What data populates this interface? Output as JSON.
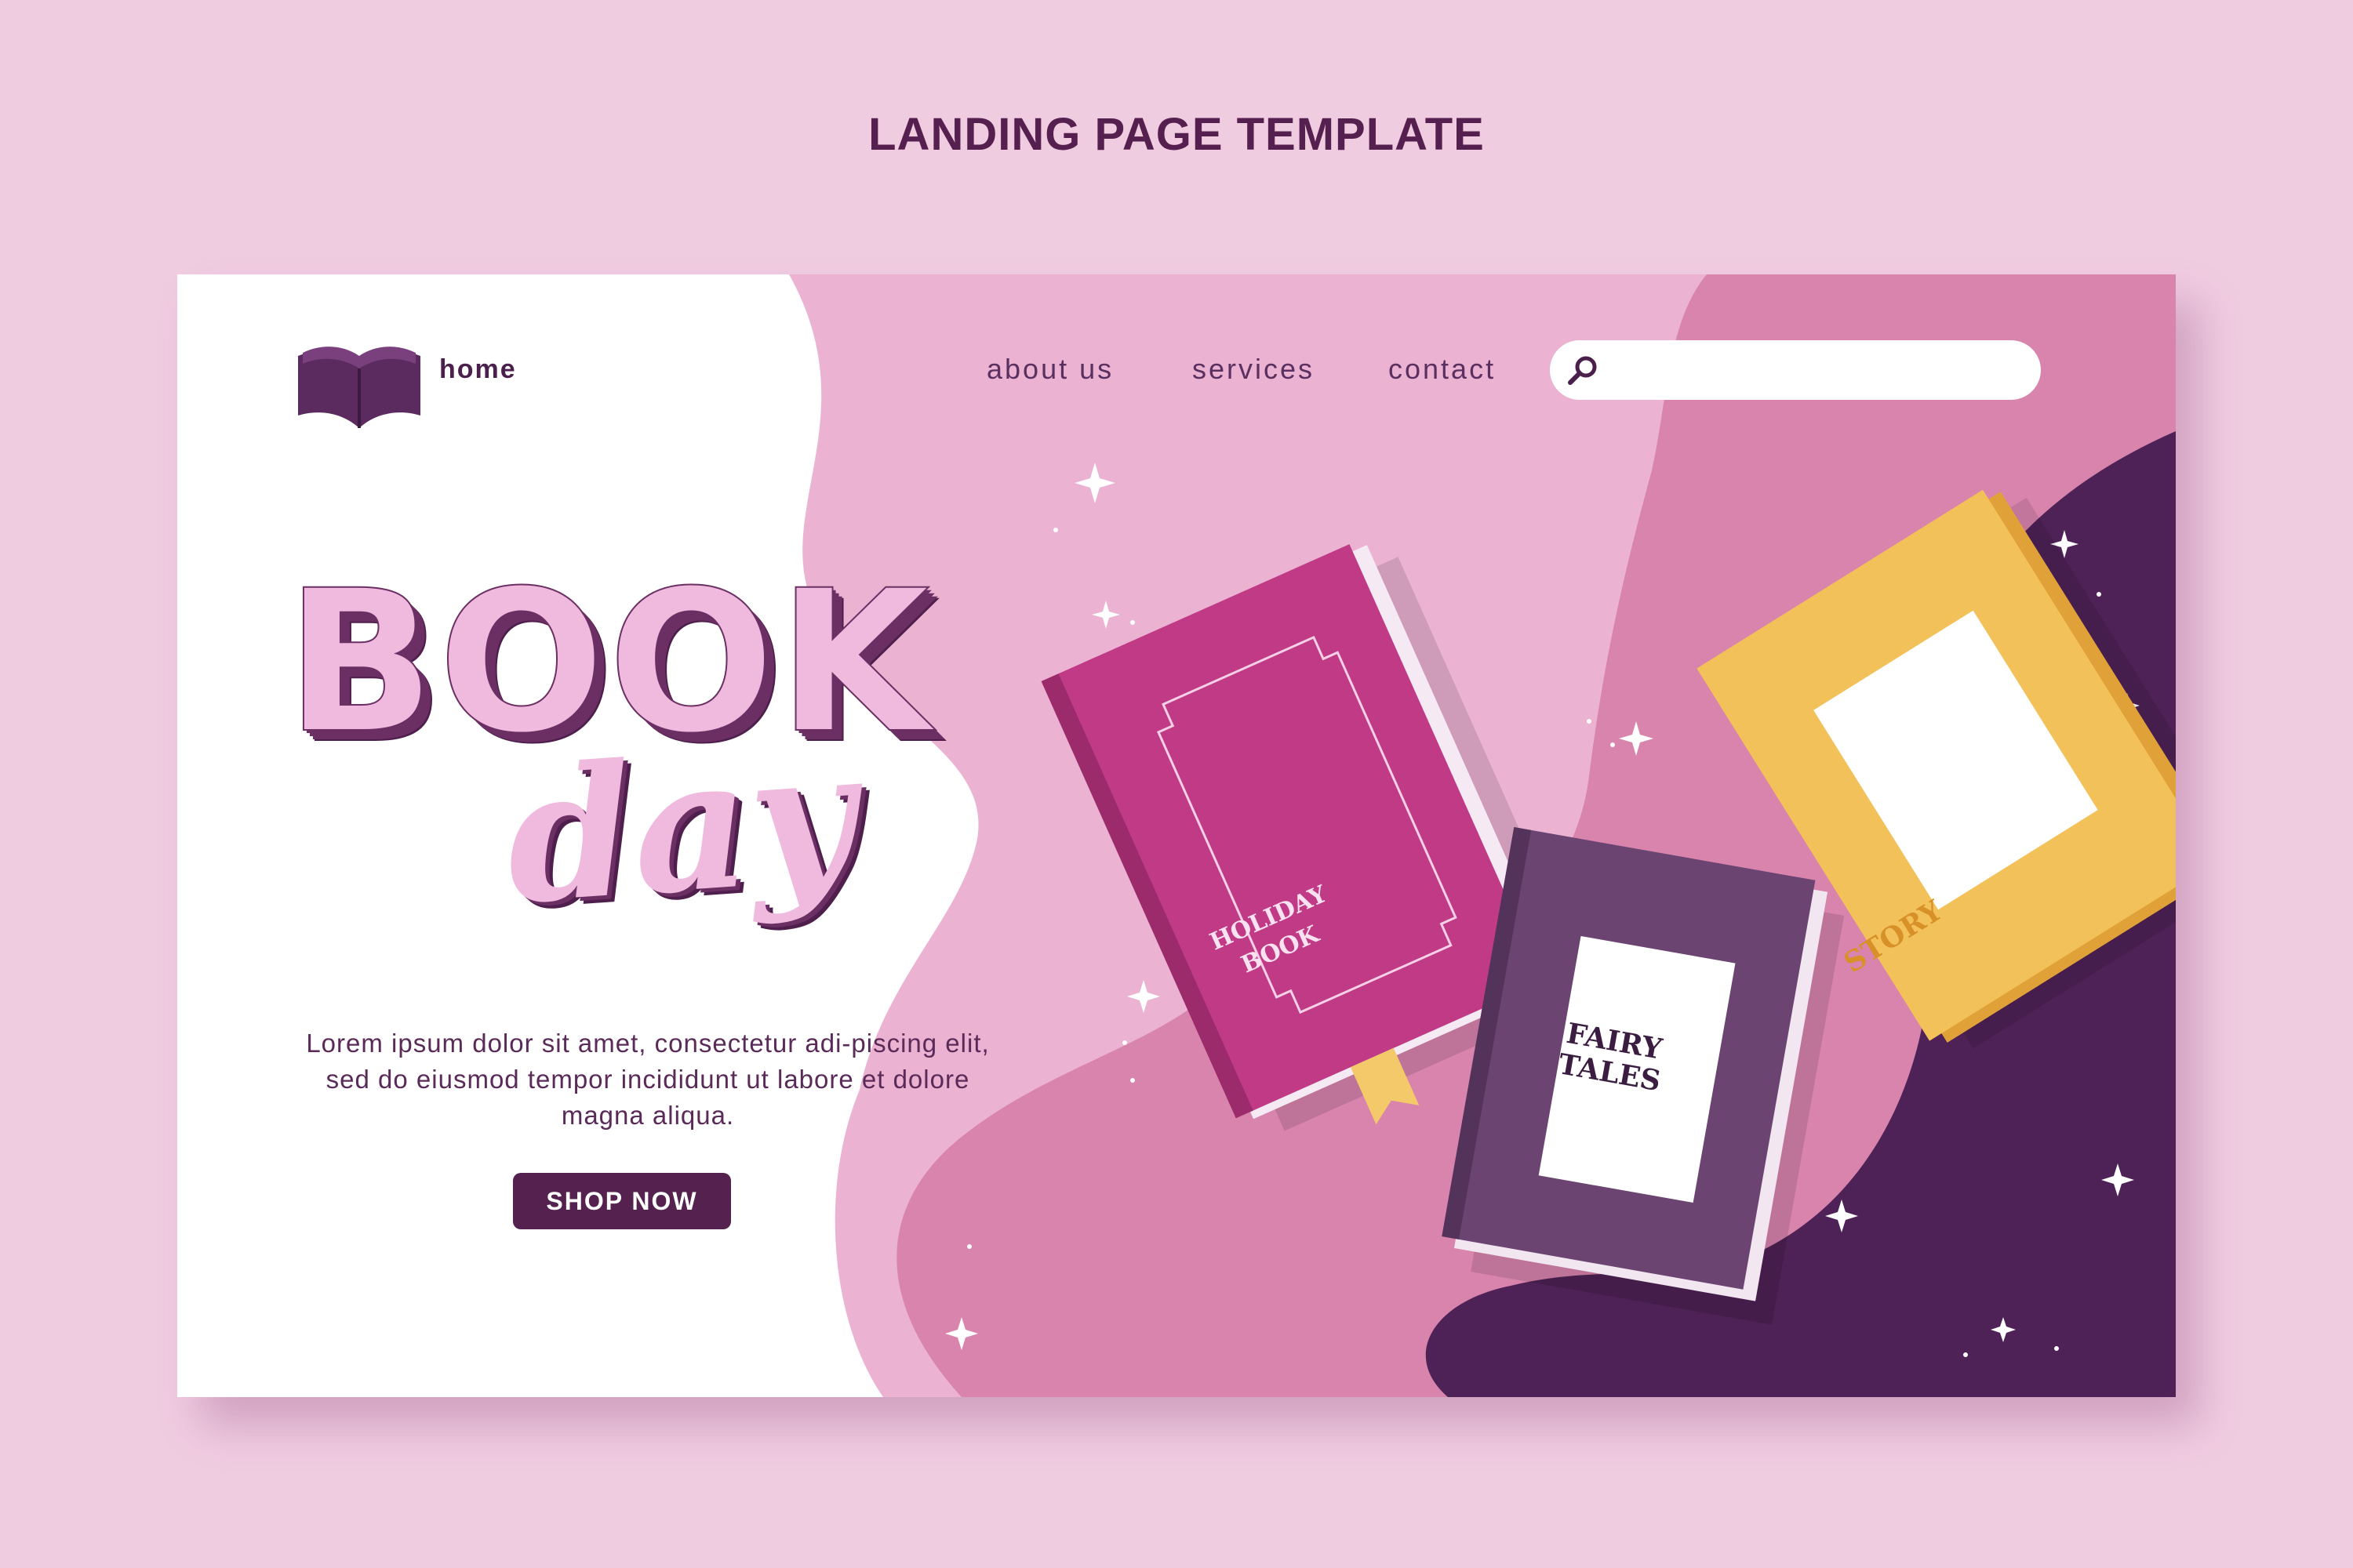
{
  "page_heading": "LANDING PAGE TEMPLATE",
  "header": {
    "home_label": "home",
    "nav": [
      "about us",
      "services",
      "contact"
    ],
    "search": {
      "placeholder": "",
      "value": ""
    }
  },
  "hero": {
    "title_line1": "BOOK",
    "title_line2": "day",
    "body": "Lorem ipsum dolor sit amet, consectetur adi-piscing elit, sed do eiusmod tempor incididunt ut labore et dolore magna aliqua.",
    "cta_label": "SHOP NOW"
  },
  "books": [
    {
      "title_line1": "HOLIDAY",
      "title_line2": "BOOK",
      "cover_color": "#c03a86"
    },
    {
      "title_line1": "FAIRY",
      "title_line2": "TALES",
      "cover_color": "#6b4471"
    },
    {
      "title_line1": "STORY",
      "cover_color": "#f3c15a"
    }
  ],
  "colors": {
    "page_bg": "#f0cce1",
    "dark_purple": "#4e2256",
    "mid_pink": "#d984ad",
    "light_pink": "#ebb2d2",
    "accent_text": "#55204f"
  }
}
